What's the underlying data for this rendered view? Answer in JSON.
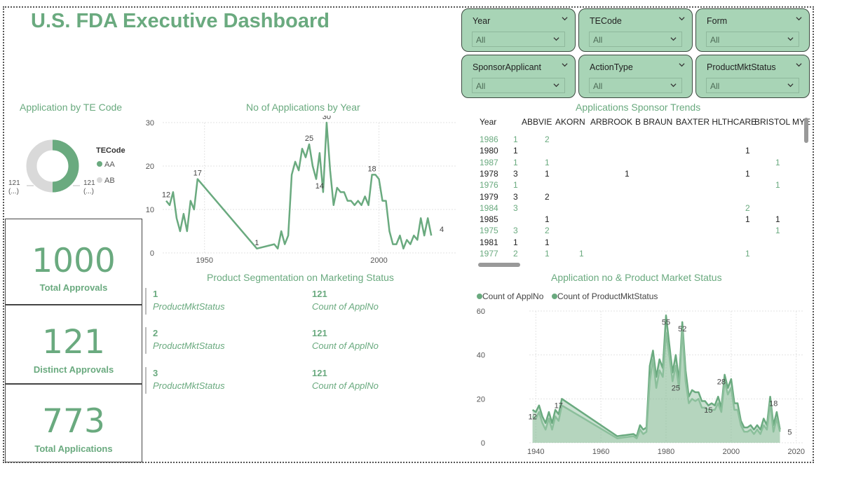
{
  "dashboard": {
    "title": "U.S. FDA Executive Dashboard"
  },
  "slicers": [
    {
      "label": "Year",
      "value": "All"
    },
    {
      "label": "TECode",
      "value": "All"
    },
    {
      "label": "Form",
      "value": "All"
    },
    {
      "label": "SponsorApplicant",
      "value": "All"
    },
    {
      "label": "ActionType",
      "value": "All"
    },
    {
      "label": "ProductMktStatus",
      "value": "All"
    }
  ],
  "te_code_donut": {
    "title": "Application by TE Code",
    "legend_title": "TECode",
    "segments": [
      {
        "name": "AA",
        "value": 121,
        "label": "121 (...)",
        "color": "#6aaa7f"
      },
      {
        "name": "AB",
        "value": 121,
        "label": "121 (...)",
        "color": "#d9d9d9"
      }
    ],
    "label_lines": [
      "121",
      "(...)"
    ]
  },
  "kpis": [
    {
      "value": "1000",
      "caption": "Total Approvals"
    },
    {
      "value": "121",
      "caption": "Distinct Approvals"
    },
    {
      "value": "773",
      "caption": "Total Applications"
    }
  ],
  "chart_data": [
    {
      "type": "line",
      "title": "No of Applications by Year",
      "xlabel": "",
      "ylabel": "",
      "xlim": [
        1938,
        2022
      ],
      "ylim": [
        0,
        30
      ],
      "x_ticks": [
        1950,
        2000
      ],
      "y_ticks": [
        0,
        10,
        20,
        30
      ],
      "color": "#6aaa7f",
      "x": [
        1939,
        1940,
        1941,
        1942,
        1943,
        1944,
        1945,
        1946,
        1947,
        1948,
        1965,
        1970,
        1971,
        1972,
        1973,
        1974,
        1975,
        1976,
        1977,
        1978,
        1979,
        1980,
        1981,
        1982,
        1983,
        1984,
        1985,
        1986,
        1987,
        1988,
        1989,
        1990,
        1991,
        1992,
        1993,
        1994,
        1995,
        1996,
        1997,
        1998,
        1999,
        2000,
        2001,
        2002,
        2003,
        2004,
        2005,
        2006,
        2007,
        2008,
        2009,
        2010,
        2011,
        2012,
        2013,
        2014,
        2015,
        2016,
        2017,
        2018
      ],
      "values": [
        12,
        11,
        14,
        8,
        5,
        9,
        5,
        12,
        10,
        17,
        1,
        2,
        1,
        5,
        2,
        4,
        18,
        21,
        19,
        24,
        22,
        25,
        20,
        17,
        23,
        14,
        30,
        19,
        11,
        15,
        14,
        14,
        12,
        12,
        11,
        12,
        11,
        13,
        11,
        18,
        18,
        17,
        12,
        12,
        5,
        2,
        2,
        4,
        1,
        3,
        2,
        4,
        3,
        8,
        4,
        8,
        4
      ],
      "point_labels": [
        {
          "x": 1939,
          "y": 12,
          "text": "12"
        },
        {
          "x": 1948,
          "y": 17,
          "text": "17"
        },
        {
          "x": 1965,
          "y": 1,
          "text": "1"
        },
        {
          "x": 1980,
          "y": 25,
          "text": "25"
        },
        {
          "x": 1985,
          "y": 30,
          "text": "30"
        },
        {
          "x": 1983,
          "y": 14,
          "text": "14"
        },
        {
          "x": 1998,
          "y": 18,
          "text": "18"
        },
        {
          "x": 2018,
          "y": 4,
          "text": "4"
        }
      ]
    },
    {
      "type": "area",
      "title": "Application no & Product Market Status",
      "xlabel": "",
      "ylabel": "",
      "xlim": [
        1938,
        2022
      ],
      "ylim": [
        0,
        60
      ],
      "x_ticks": [
        1940,
        1960,
        1980,
        2000,
        2020
      ],
      "y_ticks": [
        0,
        20,
        40,
        60
      ],
      "series": [
        {
          "name": "Count of ApplNo",
          "color": "#6aaa7f",
          "values": [
            15,
            14,
            17,
            12,
            9,
            14,
            9,
            15,
            13,
            20,
            3,
            4,
            3,
            8,
            6,
            7,
            35,
            42,
            30,
            38,
            34,
            58,
            45,
            32,
            40,
            28,
            55,
            33,
            21,
            24,
            23,
            23,
            19,
            19,
            17,
            18,
            17,
            21,
            16,
            31,
            25,
            29,
            18,
            18,
            10,
            7,
            7,
            8,
            6,
            8,
            6,
            11,
            8,
            21,
            8,
            14,
            6
          ]
        },
        {
          "name": "Count of ProductMktStatus",
          "color": "#8bbf9b",
          "values": [
            12,
            11,
            14,
            9,
            6,
            11,
            6,
            12,
            10,
            17,
            2,
            3,
            2,
            6,
            4,
            5,
            28,
            38,
            25,
            33,
            30,
            50,
            40,
            28,
            35,
            25,
            52,
            28,
            18,
            20,
            19,
            20,
            16,
            16,
            15,
            15,
            15,
            18,
            14,
            28,
            22,
            25,
            15,
            15,
            8,
            5,
            5,
            6,
            4,
            6,
            4,
            8,
            6,
            18,
            5,
            11,
            5
          ]
        }
      ],
      "point_labels": [
        {
          "x": 1939,
          "y": 12,
          "text": "12"
        },
        {
          "x": 1947,
          "y": 17,
          "text": "17"
        },
        {
          "x": 1980,
          "y": 55,
          "text": "55"
        },
        {
          "x": 1985,
          "y": 52,
          "text": "52"
        },
        {
          "x": 1983,
          "y": 25,
          "text": "25"
        },
        {
          "x": 1993,
          "y": 15,
          "text": "15"
        },
        {
          "x": 1997,
          "y": 28,
          "text": "28"
        },
        {
          "x": 2013,
          "y": 18,
          "text": "18"
        },
        {
          "x": 2018,
          "y": 5,
          "text": "5"
        }
      ]
    }
  ],
  "segmentation": {
    "title": "Product Segmentation on Marketing Status",
    "items": [
      {
        "status": "1",
        "status_label": "ProductMktStatus",
        "count": "121",
        "count_label": "Count of ApplNo"
      },
      {
        "status": "2",
        "status_label": "ProductMktStatus",
        "count": "121",
        "count_label": "Count of ApplNo"
      },
      {
        "status": "3",
        "status_label": "ProductMktStatus",
        "count": "121",
        "count_label": "Count of ApplNo"
      }
    ]
  },
  "sponsor_matrix": {
    "title": "Applications Sponsor Trends",
    "columns": [
      "Year",
      "ABBVIE",
      "AKORN",
      "ARBROOK",
      "B BRAUN",
      "BAXTER HLTHCARE",
      "BRISTOL MYE"
    ],
    "rows": [
      {
        "year": "1986",
        "green": true,
        "cells": [
          "1",
          "2",
          "",
          "",
          "",
          "",
          ""
        ]
      },
      {
        "year": "1980",
        "green": false,
        "cells": [
          "1",
          "",
          "",
          "",
          "",
          "1",
          ""
        ]
      },
      {
        "year": "1987",
        "green": true,
        "cells": [
          "1",
          "1",
          "",
          "",
          "",
          "",
          "1"
        ]
      },
      {
        "year": "1978",
        "green": false,
        "cells": [
          "3",
          "1",
          "",
          "1",
          "",
          "1",
          ""
        ]
      },
      {
        "year": "1976",
        "green": true,
        "cells": [
          "1",
          "",
          "",
          "",
          "",
          "",
          "1"
        ]
      },
      {
        "year": "1979",
        "green": false,
        "cells": [
          "3",
          "2",
          "",
          "",
          "",
          "",
          ""
        ]
      },
      {
        "year": "1984",
        "green": true,
        "cells": [
          "3",
          "",
          "",
          "",
          "",
          "2",
          ""
        ]
      },
      {
        "year": "1985",
        "green": false,
        "cells": [
          "",
          "1",
          "",
          "",
          "",
          "1",
          "1"
        ]
      },
      {
        "year": "1975",
        "green": true,
        "cells": [
          "3",
          "2",
          "",
          "",
          "",
          "",
          "1"
        ]
      },
      {
        "year": "1981",
        "green": false,
        "cells": [
          "1",
          "1",
          "",
          "",
          "",
          "",
          ""
        ]
      },
      {
        "year": "1977",
        "green": true,
        "cells": [
          "2",
          "1",
          "1",
          "",
          "",
          "1",
          ""
        ]
      }
    ]
  }
}
